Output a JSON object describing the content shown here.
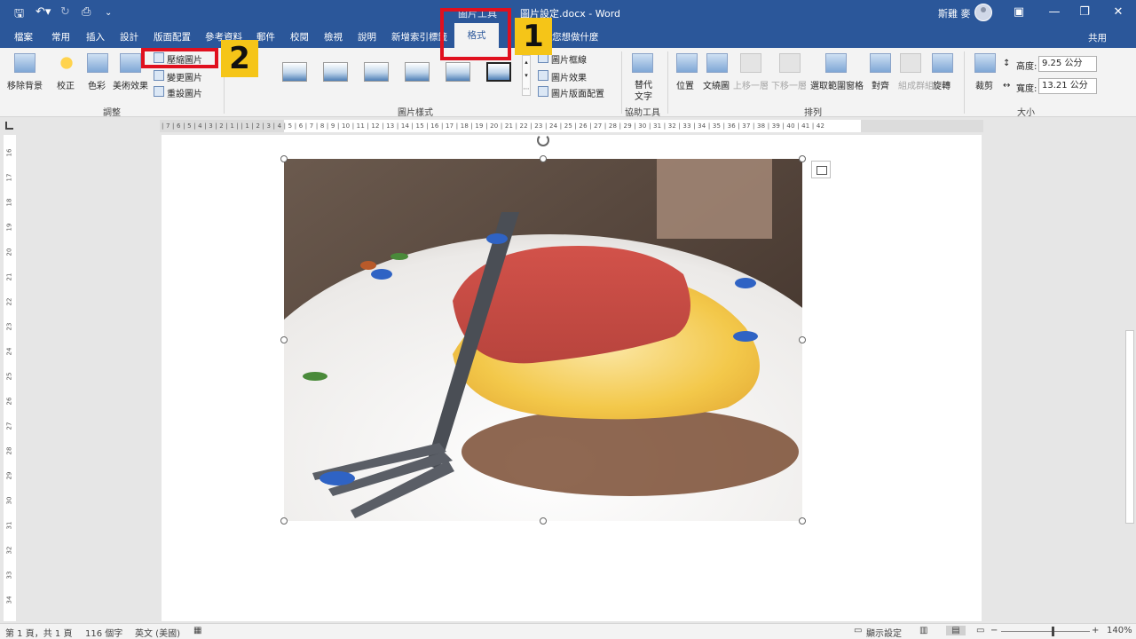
{
  "app": {
    "title": "圖片設定.docx - Word",
    "context_label": "圖片工具",
    "user": "斯雞 麥"
  },
  "tabs": [
    "檔案",
    "常用",
    "插入",
    "設計",
    "版面配置",
    "參考資料",
    "郵件",
    "校閱",
    "檢視",
    "說明",
    "新增索引標籤"
  ],
  "active_tab": "格式",
  "tell_me": "您想做什麼",
  "share": "共用",
  "ribbon": {
    "adjust": {
      "remove_bg": "移除背景",
      "corrections": "校正",
      "color": "色彩",
      "artistic": "美術效果",
      "compress": "壓縮圖片",
      "change": "變更圖片",
      "reset": "重設圖片",
      "group_label": "調整"
    },
    "styles": {
      "border": "圖片框線",
      "effects": "圖片效果",
      "layout": "圖片版面配置",
      "group_label": "圖片樣式"
    },
    "accessibility": {
      "alt_text_line1": "替代",
      "alt_text_line2": "文字",
      "group_label": "協助工具"
    },
    "arrange": {
      "position": "位置",
      "wrap_text": "文繞圖",
      "bring_forward": "上移一層",
      "send_backward": "下移一層",
      "selection_pane": "選取範圍窗格",
      "align": "對齊",
      "group": "組成群組",
      "rotate": "旋轉",
      "group_label": "排列"
    },
    "size": {
      "crop": "裁剪",
      "height_label": "高度:",
      "height_value": "9.25 公分",
      "width_label": "寬度:",
      "width_value": "13.21 公分",
      "group_label": "大小"
    }
  },
  "ruler": {
    "horizontal": "| 7 | 6 | 5 | 4 | 3 | 2 | 1 |   | 1 | 2 | 3 | 4 | 5 | 6 | 7 | 8 | 9 | 10 | 11 | 12 | 13 | 14 | 15 | 16 | 17 | 18 | 19 | 20 | 21 | 22 | 23 | 24 | 25 | 26 | 27 | 28 | 29 | 30 | 31 | 32 | 33 | 34 | 35 | 36 | 37 | 38 | 39 | 40 | 41 | 42",
    "vertical": [
      "16",
      "17",
      "18",
      "19",
      "20",
      "21",
      "22",
      "23",
      "24",
      "25",
      "26",
      "27",
      "28",
      "29",
      "30",
      "31",
      "32",
      "33",
      "34"
    ]
  },
  "status": {
    "page": "第 1 頁，共 1 頁",
    "words": "116 個字",
    "language": "英文 (美國)",
    "display_settings": "顯示設定",
    "zoom": "140%"
  },
  "annotations": {
    "badge1": "1",
    "badge2": "2"
  },
  "colors": {
    "word_blue": "#2b579a",
    "highlight_red": "#e0101e",
    "badge_yellow": "#f5c518"
  }
}
